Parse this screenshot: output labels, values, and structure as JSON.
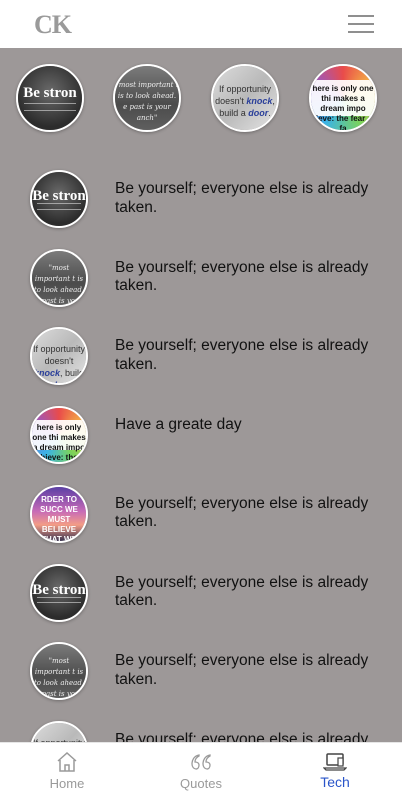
{
  "app": {
    "logo": "CK"
  },
  "stories": [
    {
      "name": "story-be-strong",
      "thumb": "be-strong",
      "text": "Be stron"
    },
    {
      "name": "story-storm",
      "thumb": "storm",
      "text": "\"most important t is to look ahead. e past is your anch\""
    },
    {
      "name": "story-opportunity",
      "thumb": "opportunity",
      "text": "If opportunity doesn't knock, build a door."
    },
    {
      "name": "story-dream",
      "thumb": "dream",
      "text": "here is only one thi makes a dream impo hieve: the fear of fa"
    }
  ],
  "list": [
    {
      "thumb": "be-strong",
      "thumb_text": "Be stron",
      "text": "Be yourself; everyone else is already taken."
    },
    {
      "thumb": "storm",
      "thumb_text": "\"most important t is to look ahead. e past is your anch\"",
      "text": "Be yourself; everyone else is already taken."
    },
    {
      "thumb": "opportunity",
      "thumb_text": "If opportunity doesn't knock, build a door.",
      "text": "Be yourself; everyone else is already taken."
    },
    {
      "thumb": "dream",
      "thumb_text": "here is only one thi makes a dream impo hieve: the fear of fa",
      "text": "Have a greate day"
    },
    {
      "thumb": "sunset",
      "thumb_text": "RDER TO SUCC WE MUST BELIEVE THAT WE CAN",
      "text": "Be yourself; everyone else is already taken."
    },
    {
      "thumb": "be-strong",
      "thumb_text": "Be stron",
      "text": "Be yourself; everyone else is already taken."
    },
    {
      "thumb": "storm",
      "thumb_text": "\"most important t is to look ahead. e past is your anch\"",
      "text": "Be yourself; everyone else is already taken."
    },
    {
      "thumb": "opportunity",
      "thumb_text": "If opportunity doesn't knock, build a door.",
      "text": "Be yourself; everyone else is already taken."
    }
  ],
  "tabs": [
    {
      "id": "home",
      "label": "Home",
      "icon": "home-icon",
      "active": false
    },
    {
      "id": "quotes",
      "label": "Quotes",
      "icon": "quote-icon",
      "active": false
    },
    {
      "id": "tech",
      "label": "Tech",
      "icon": "laptop-icon",
      "active": true
    }
  ],
  "colors": {
    "background": "#9d9898",
    "active_tab": "#2a55c9",
    "inactive_tab": "#9a9a9a"
  }
}
